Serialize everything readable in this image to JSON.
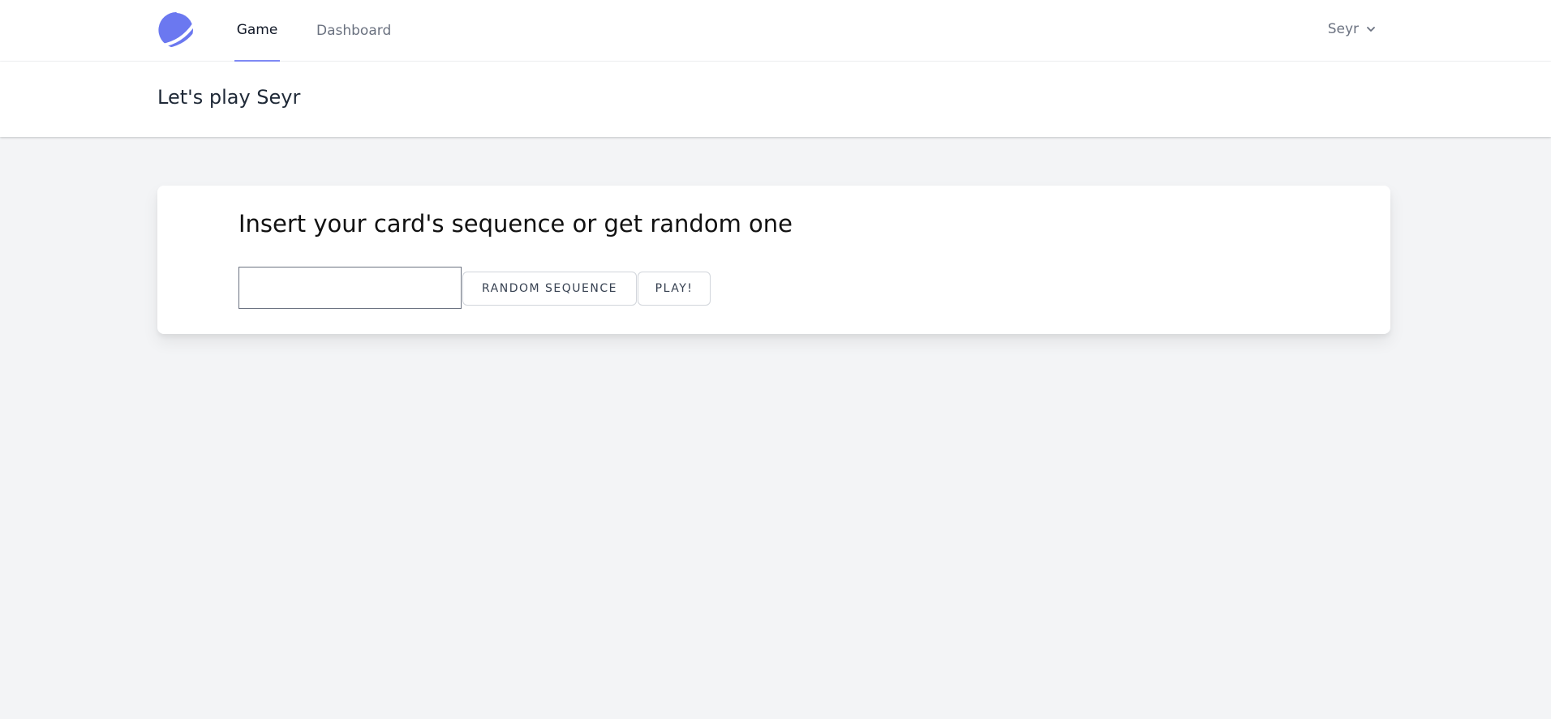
{
  "nav": {
    "logo_icon": "crescent-planet-logo-icon",
    "items": [
      {
        "label": "Game",
        "active": true
      },
      {
        "label": "Dashboard",
        "active": false
      }
    ],
    "user": {
      "name": "Seyr",
      "icon": "chevron-down-icon"
    }
  },
  "header": {
    "title": "Let's play Seyr"
  },
  "card": {
    "heading": "Insert your card's sequence or get random one",
    "sequence_input": {
      "value": "",
      "placeholder": ""
    },
    "random_button_label": "RANDOM SEQUENCE",
    "play_button_label": "PLAY!"
  },
  "colors": {
    "accent": "#818cf8",
    "logo": "#6b78f0",
    "background": "#f3f4f6"
  }
}
